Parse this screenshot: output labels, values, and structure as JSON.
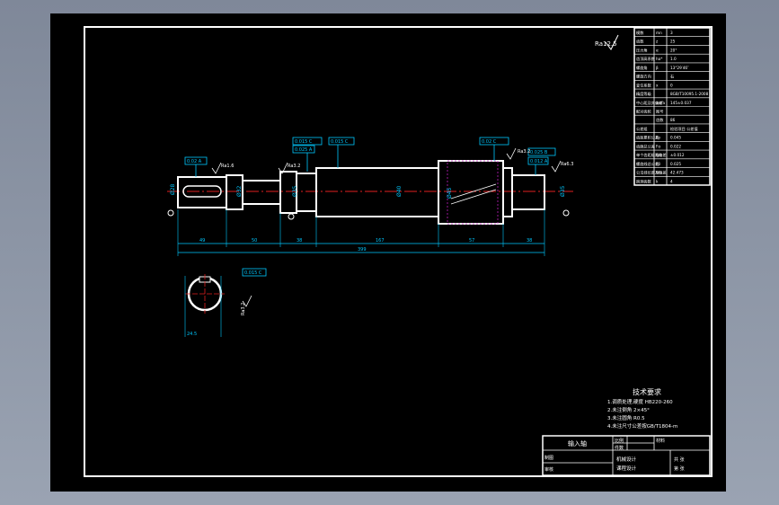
{
  "drawing": {
    "title": "输入轴",
    "tech_req": {
      "heading": "技术要求",
      "items": [
        "1.调质处理,硬度 HB220-260",
        "2.未注倒角 2×45°",
        "3.未注圆角 R0.5",
        "4.未注尺寸公差按GB/T1804-m"
      ]
    },
    "dims": {
      "seg1": "49",
      "seg2": "50",
      "seg3": "38",
      "seg4": "167",
      "seg5": "57",
      "seg6": "38",
      "total": "399",
      "dia1": "Ø28",
      "dia2": "Ø32",
      "dia3": "Ø35",
      "dia4": "Ø40",
      "dia5": "Ø45",
      "dia6": "Ø35"
    },
    "tolerances": {
      "t1": "0.02 A",
      "t2": "0.015 C",
      "t3": "0.025 A",
      "t4": "0.015 C",
      "t5": "0.02 C",
      "t6": "0.025 B",
      "t7": "0.012 A"
    },
    "roughness": [
      "Ra1.6",
      "Ra3.2",
      "Ra6.3",
      "Ra12.5"
    ],
    "section": {
      "dim": "24.5",
      "rough": "Ra3.2"
    },
    "params": [
      {
        "label": "模数",
        "sym": "mn",
        "value": "3"
      },
      {
        "label": "齿数",
        "sym": "z",
        "value": "25"
      },
      {
        "label": "压力角",
        "sym": "α",
        "value": "20°"
      },
      {
        "label": "齿顶高系数",
        "sym": "ha*",
        "value": "1.0"
      },
      {
        "label": "螺旋角",
        "sym": "β",
        "value": "13°29′46″"
      },
      {
        "label": "螺旋方向",
        "sym": "",
        "value": "右"
      },
      {
        "label": "变位系数",
        "sym": "x",
        "value": "0"
      },
      {
        "label": "精度等级",
        "sym": "",
        "value": "8GB/T10095.1-2008"
      },
      {
        "label": "中心距及其偏差",
        "sym": "a±fa",
        "value": "145±0.037"
      },
      {
        "label": "配对齿轮",
        "sym": "图号",
        "value": ""
      },
      {
        "label": "",
        "sym": "齿数",
        "value": "86"
      },
      {
        "label": "公差组",
        "sym": "",
        "value": "检验项目 公差值"
      },
      {
        "label": "齿距累积公差",
        "sym": "Fp",
        "value": "0.045"
      },
      {
        "label": "齿廓总公差",
        "sym": "Fα",
        "value": "0.022"
      },
      {
        "label": "单个齿距极限偏差",
        "sym": "fpt",
        "value": "±0.012"
      },
      {
        "label": "螺旋线总公差",
        "sym": "Fβ",
        "value": "0.025"
      },
      {
        "label": "公法线长度及偏差",
        "sym": "W",
        "value": "42.473"
      },
      {
        "label": "跨测齿数",
        "sym": "k",
        "value": "4"
      }
    ],
    "titleblock": {
      "part_name": "输入轴",
      "scale_label": "比例",
      "qty_label": "件数",
      "material_label": "材料",
      "drawn_label": "制图",
      "checked_label": "审核",
      "design_label": "课程设计",
      "school": "机械设计",
      "sheet_label": "共 张",
      "sheet_no": "第 张"
    }
  }
}
